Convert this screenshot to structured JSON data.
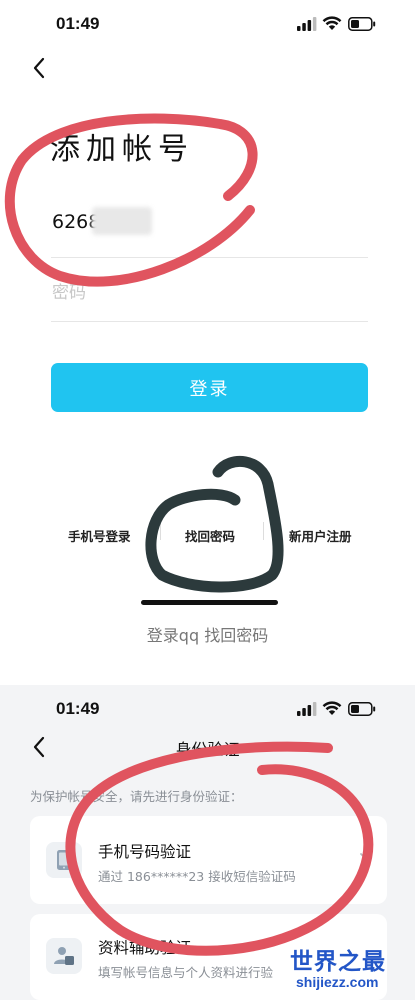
{
  "screen1": {
    "time": "01:49",
    "title": "添加帐号",
    "account_value": "6268",
    "password_placeholder": "密码",
    "login_label": "登录",
    "options": [
      "手机号登录",
      "找回密码",
      "新用户注册"
    ]
  },
  "caption": "登录qq 找回密码",
  "screen2": {
    "time": "01:49",
    "title": "身份验证",
    "hint": "为保护帐号安全，请先进行身份验证：",
    "cards": [
      {
        "title": "手机号码验证",
        "subtitle": "通过 186******23 接收短信验证码"
      },
      {
        "title": "资料辅助验证",
        "subtitle": "填写帐号信息与个人资料进行验"
      }
    ]
  },
  "watermark": {
    "cn": "世界之最",
    "en": "shijiezz.com"
  },
  "colors": {
    "primary": "#20c4f0",
    "red_annotation": "#e0545f",
    "dark_annotation": "#2c3a3c",
    "watermark": "#2356c7"
  }
}
